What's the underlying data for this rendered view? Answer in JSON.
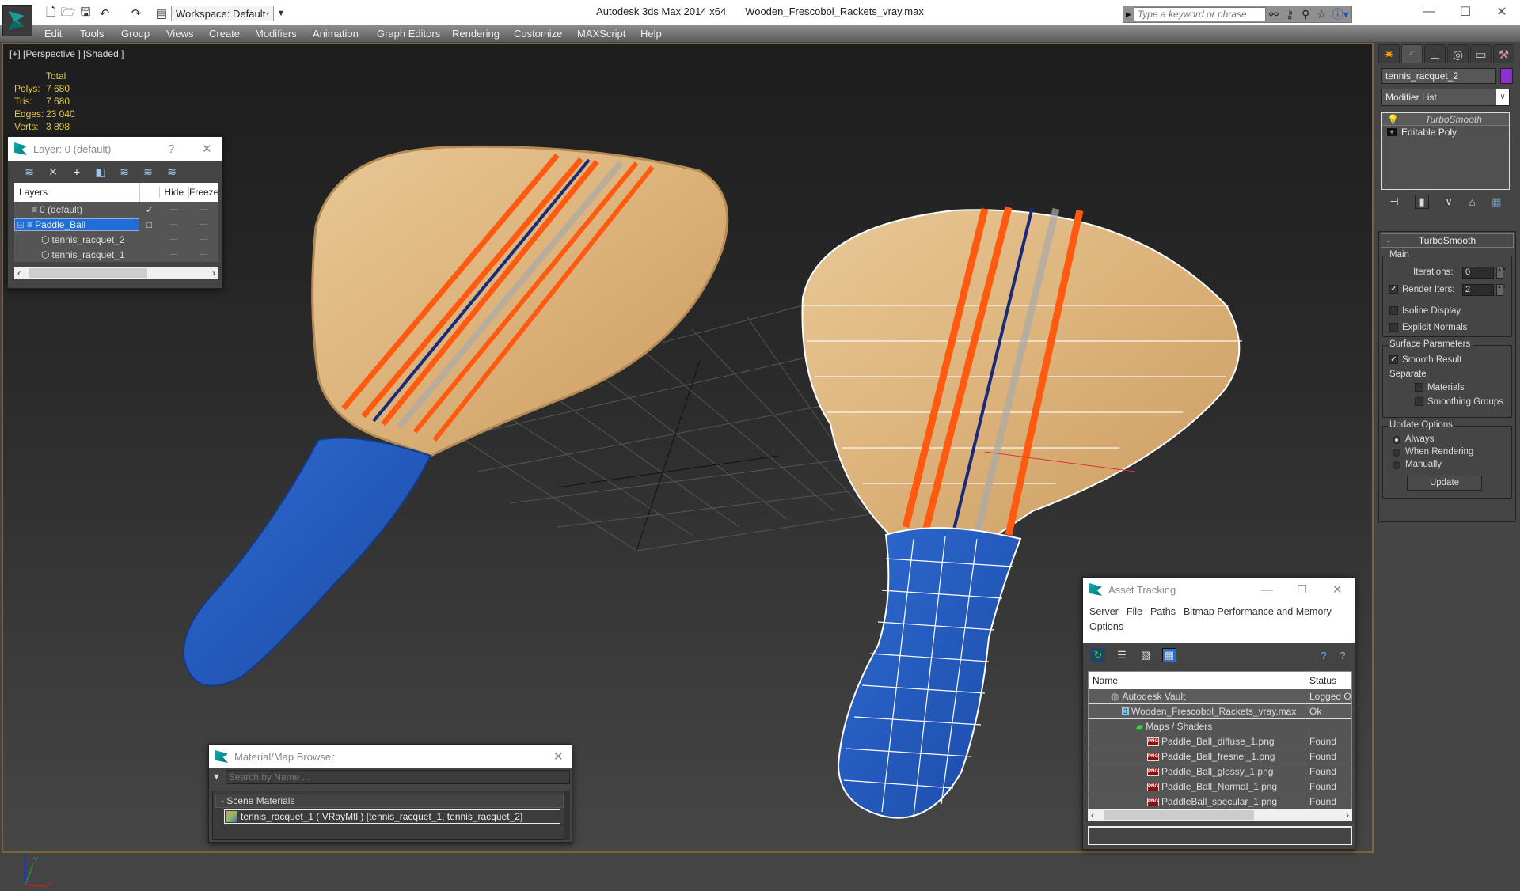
{
  "titlebar": {
    "app": "Autodesk 3ds Max  2014 x64",
    "file": "Wooden_Frescobol_Rackets_vray.max",
    "workspace": "Workspace: Default",
    "search_placeholder": "Type a keyword or phrase",
    "icons": [
      "new-file-icon",
      "open-file-icon",
      "save-icon",
      "undo-icon",
      "redo-icon",
      "project-folder-icon"
    ],
    "search_icons": [
      "binoculars-icon",
      "key-icon",
      "satellite-icon",
      "star-icon",
      "help-icon"
    ]
  },
  "menu": [
    "Edit",
    "Tools",
    "Group",
    "Views",
    "Create",
    "Modifiers",
    "Animation",
    "Graph Editors",
    "Rendering",
    "Customize",
    "MAXScript",
    "Help"
  ],
  "viewport": {
    "label": "[+] [Perspective ] [Shaded ]",
    "stats": {
      "header": "Total",
      "rows": [
        {
          "k": "Polys:",
          "v": "7 680"
        },
        {
          "k": "Tris:",
          "v": "7 680"
        },
        {
          "k": "Edges:",
          "v": "23 040"
        },
        {
          "k": "Verts:",
          "v": "3 898"
        }
      ]
    },
    "axis": {
      "x": "X",
      "y": "Y",
      "z": "Z"
    }
  },
  "layer_window": {
    "title": "Layer: 0 (default)",
    "help": "?",
    "columns": [
      "Layers",
      "",
      "Hide",
      "Freeze"
    ],
    "rows": [
      {
        "name": "0 (default)",
        "active": "✓",
        "indent": 1
      },
      {
        "name": "Paddle_Ball",
        "active": "□",
        "indent": 0,
        "selected": true
      },
      {
        "name": "tennis_racquet_2",
        "active": "",
        "indent": 2
      },
      {
        "name": "tennis_racquet_1",
        "active": "",
        "indent": 2
      }
    ]
  },
  "command_panel": {
    "object_name": "tennis_racquet_2",
    "object_color": "#8e2fcf",
    "modifier_list": "Modifier List",
    "stack": [
      "TurboSmooth",
      "Editable Poly"
    ],
    "rollout": {
      "title": "TurboSmooth",
      "main_label": "Main",
      "iterations_label": "Iterations:",
      "iterations": "0",
      "render_iters_label": "Render Iters:",
      "render_iters": "2",
      "render_iters_checked": true,
      "isoline": "Isoline Display",
      "explicit_normals": "Explicit Normals",
      "surface_label": "Surface Parameters",
      "smooth_result": "Smooth Result",
      "separate": "Separate",
      "materials": "Materials",
      "smoothing_groups": "Smoothing Groups",
      "update_label": "Update Options",
      "always": "Always",
      "when_rendering": "When Rendering",
      "manually": "Manually",
      "update_button": "Update"
    }
  },
  "material_browser": {
    "title": "Material/Map Browser",
    "search_placeholder": "Search by Name ...",
    "section": "- Scene Materials",
    "entry": "tennis_racquet_1  ( VRayMtl )  [tennis_racquet_1, tennis_racquet_2]"
  },
  "asset_tracking": {
    "title": "Asset Tracking",
    "menu": [
      "Server",
      "File",
      "Paths",
      "Bitmap Performance and Memory",
      "Options"
    ],
    "columns": [
      "Name",
      "Status"
    ],
    "rows": [
      {
        "name": "Autodesk Vault",
        "status": "Logged Out",
        "indent": 1,
        "icon": "vault-icon"
      },
      {
        "name": "Wooden_Frescobol_Rackets_vray.max",
        "status": "Ok",
        "indent": 2,
        "icon": "max-file-icon"
      },
      {
        "name": "Maps / Shaders",
        "status": "",
        "indent": 3,
        "icon": "maps-icon"
      },
      {
        "name": "Paddle_Ball_diffuse_1.png",
        "status": "Found",
        "indent": 4,
        "icon": "png-icon"
      },
      {
        "name": "Paddle_Ball_fresnel_1.png",
        "status": "Found",
        "indent": 4,
        "icon": "png-icon"
      },
      {
        "name": "Paddle_Ball_glossy_1.png",
        "status": "Found",
        "indent": 4,
        "icon": "png-icon"
      },
      {
        "name": "Paddle_Ball_Normal_1.png",
        "status": "Found",
        "indent": 4,
        "icon": "png-icon"
      },
      {
        "name": "PaddleBall_specular_1.png",
        "status": "Found",
        "indent": 4,
        "icon": "png-icon"
      }
    ]
  }
}
